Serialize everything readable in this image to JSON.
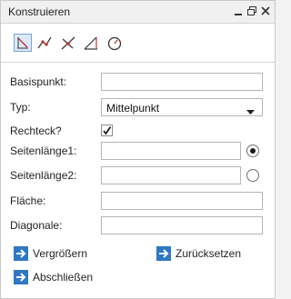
{
  "window": {
    "title": "Konstruieren"
  },
  "toolbar": {
    "tools": [
      {
        "icon": "point-line-tool-icon",
        "selected": true
      },
      {
        "icon": "polyline-tool-icon",
        "selected": false
      },
      {
        "icon": "intersection-tool-icon",
        "selected": false
      },
      {
        "icon": "angle-tool-icon",
        "selected": false
      },
      {
        "icon": "circle-tool-icon",
        "selected": false
      }
    ]
  },
  "form": {
    "basispunkt_label": "Basispunkt:",
    "basispunkt_value": "",
    "typ_label": "Typ:",
    "typ_value": "Mittelpunkt",
    "rechteck_label": "Rechteck?",
    "rechteck_checked": true,
    "seite1_label": "Seitenlänge1:",
    "seite1_value": "",
    "seite1_radio_selected": true,
    "seite2_label": "Seitenlänge2:",
    "seite2_value": "",
    "seite2_radio_selected": false,
    "flaeche_label": "Fläche:",
    "flaeche_value": "",
    "diagonale_label": "Diagonale:",
    "diagonale_value": ""
  },
  "actions": {
    "vergroessern": "Vergrößern",
    "zuruecksetzen": "Zurücksetzen",
    "abschliessen": "Abschließen"
  },
  "colors": {
    "accent": "#2f78c4",
    "selected_bg": "#dbe9f8"
  }
}
